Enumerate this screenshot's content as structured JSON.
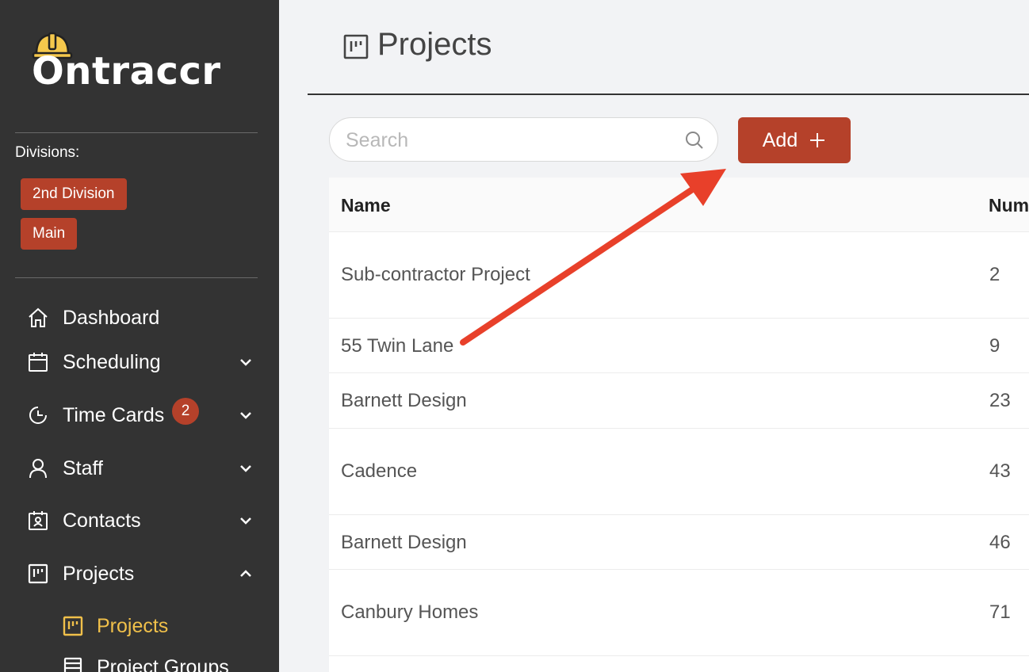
{
  "app": {
    "logo_text": "Ontraccr"
  },
  "sidebar": {
    "divisions_label": "Divisions:",
    "divisions": [
      "2nd Division",
      "Main"
    ],
    "nav": [
      {
        "label": "Dashboard",
        "icon": "home-icon"
      },
      {
        "label": "Scheduling",
        "icon": "calendar-icon"
      },
      {
        "label": "Time Cards",
        "icon": "clock-icon",
        "badge": "2"
      },
      {
        "label": "Staff",
        "icon": "user-icon"
      },
      {
        "label": "Contacts",
        "icon": "contacts-icon"
      },
      {
        "label": "Projects",
        "icon": "projects-icon"
      }
    ],
    "sub_nav": [
      {
        "label": "Projects",
        "icon": "projects-icon",
        "active": true
      },
      {
        "label": "Project Groups",
        "icon": "project-groups-icon"
      }
    ]
  },
  "header": {
    "title": "Projects"
  },
  "toolbar": {
    "search_placeholder": "Search",
    "search_value": "",
    "add_label": "Add"
  },
  "table": {
    "columns": [
      "Name",
      "Num"
    ],
    "rows": [
      {
        "name": "Sub-contractor Project",
        "number": "2"
      },
      {
        "name": "55 Twin Lane",
        "number": "9"
      },
      {
        "name": "Barnett Design",
        "number": "23"
      },
      {
        "name": "Cadence",
        "number": "43"
      },
      {
        "name": "Barnett Design",
        "number": "46"
      },
      {
        "name": "Canbury Homes",
        "number": "71"
      }
    ]
  },
  "colors": {
    "sidebar_bg": "#333333",
    "accent": "#b5412a",
    "active_nav": "#f0c04a",
    "annotation_arrow": "#e8402a"
  }
}
